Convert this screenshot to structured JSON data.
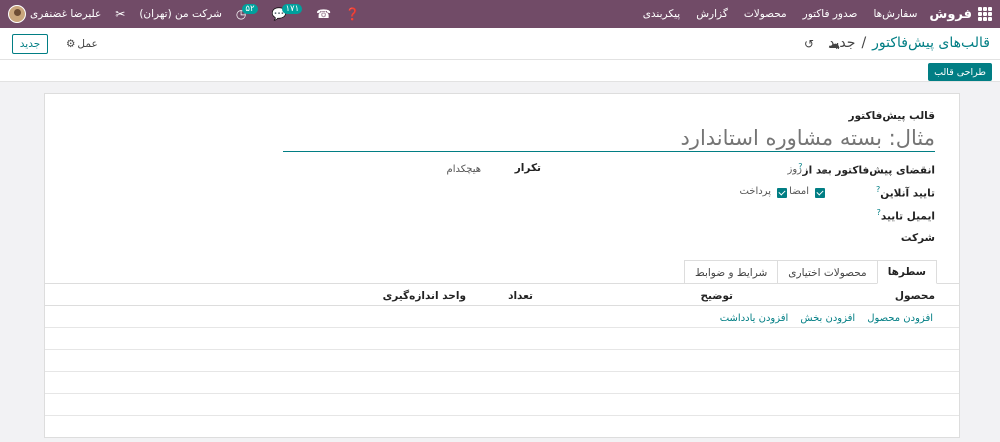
{
  "navbar": {
    "app_name": "فروش",
    "menu": [
      "سفارش‌ها",
      "صدور فاکتور",
      "محصولات",
      "گزارش",
      "پیکربندی"
    ],
    "user_name": "علیرضا غضنفری",
    "company": "شرکت من (تهران)",
    "activity_count": "۵۲",
    "message_count": "۱۷۱"
  },
  "control": {
    "breadcrumb_parent": "قالب‌های پیش‌فاکتور",
    "breadcrumb_sep": "/",
    "breadcrumb_current": "جدید",
    "new_button": "جدید",
    "action_label": "عمل"
  },
  "status": {
    "design_button": "طراحی قالب"
  },
  "form": {
    "section_label": "قالب پیش‌فاکتور",
    "name_value": "مثال: بسته مشاوره استاندارد",
    "expiry_label": "انقضای پیش‌فاکتور بعد از",
    "expiry_unit": "روز",
    "recurrence_label": "تکرار",
    "recurrence_value": "هیچکدام",
    "online_confirm_label": "تایید آنلاین",
    "signature_label": "امضا",
    "payment_label": "پرداخت",
    "email_confirm_label": "ایمیل تایید",
    "company_label": "شرکت",
    "help_mark": "?"
  },
  "tabs": [
    "سطرها",
    "محصولات اختیاری",
    "شرایط و ضوابط"
  ],
  "lines_table": {
    "columns": [
      "محصول",
      "توضیح",
      "تعداد",
      "واحد اندازه‌گیری"
    ],
    "add_product": "افزودن محصول",
    "add_section": "افزودن بخش",
    "add_note": "افزودن یادداشت"
  }
}
